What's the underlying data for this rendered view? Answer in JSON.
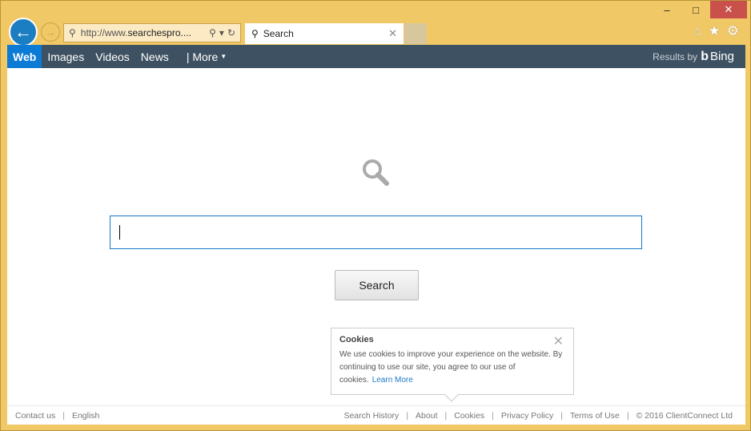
{
  "browser": {
    "address_url_prefix": "http://www.",
    "address_url_domain": "searchespro....",
    "tab_title": "Search",
    "window_controls": {
      "minimize": "–",
      "maximize": "□",
      "close": "✕"
    },
    "tools": {
      "home": "⌂",
      "favorites": "★",
      "settings": "⚙"
    }
  },
  "nav": {
    "items": [
      {
        "label": "Web",
        "active": true
      },
      {
        "label": "Images"
      },
      {
        "label": "Videos"
      },
      {
        "label": "News"
      }
    ],
    "more_label": "| More",
    "results_by": "Results by",
    "bing_label": "Bing"
  },
  "search": {
    "input_value": "",
    "button_label": "Search"
  },
  "cookie_popup": {
    "title": "Cookies",
    "text": "We use cookies to improve your experience on the website. By continuing to use our site, you agree to our use of cookies.",
    "link": "Learn More"
  },
  "footer": {
    "left": [
      "Contact us",
      "English"
    ],
    "right": [
      "Search History",
      "About",
      "Cookies",
      "Privacy Policy",
      "Terms of Use",
      "© 2016 ClientConnect Ltd"
    ]
  }
}
